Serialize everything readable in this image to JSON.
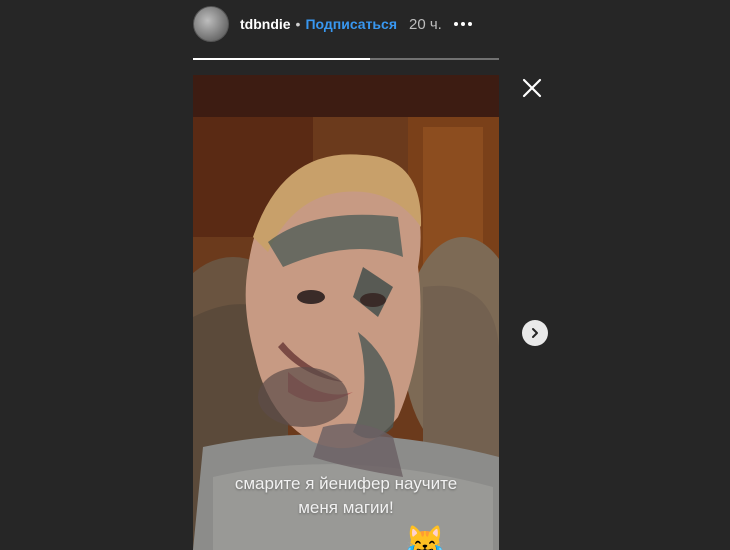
{
  "header": {
    "username": "tdbndie",
    "separator": "•",
    "subscribe_label": "Подписаться",
    "time": "20 ч."
  },
  "progress": {
    "fraction": 0.58
  },
  "story": {
    "caption_line1": "смарите я йенифер научите",
    "caption_line2": "меня магии!",
    "emoji": "😹"
  },
  "icons": {
    "avatar": "profile-avatar",
    "more": "more-dots-icon",
    "close": "close-icon",
    "next": "chevron-right-icon"
  },
  "colors": {
    "background": "#262626",
    "subscribe": "#3897f0",
    "text": "#ffffff"
  }
}
